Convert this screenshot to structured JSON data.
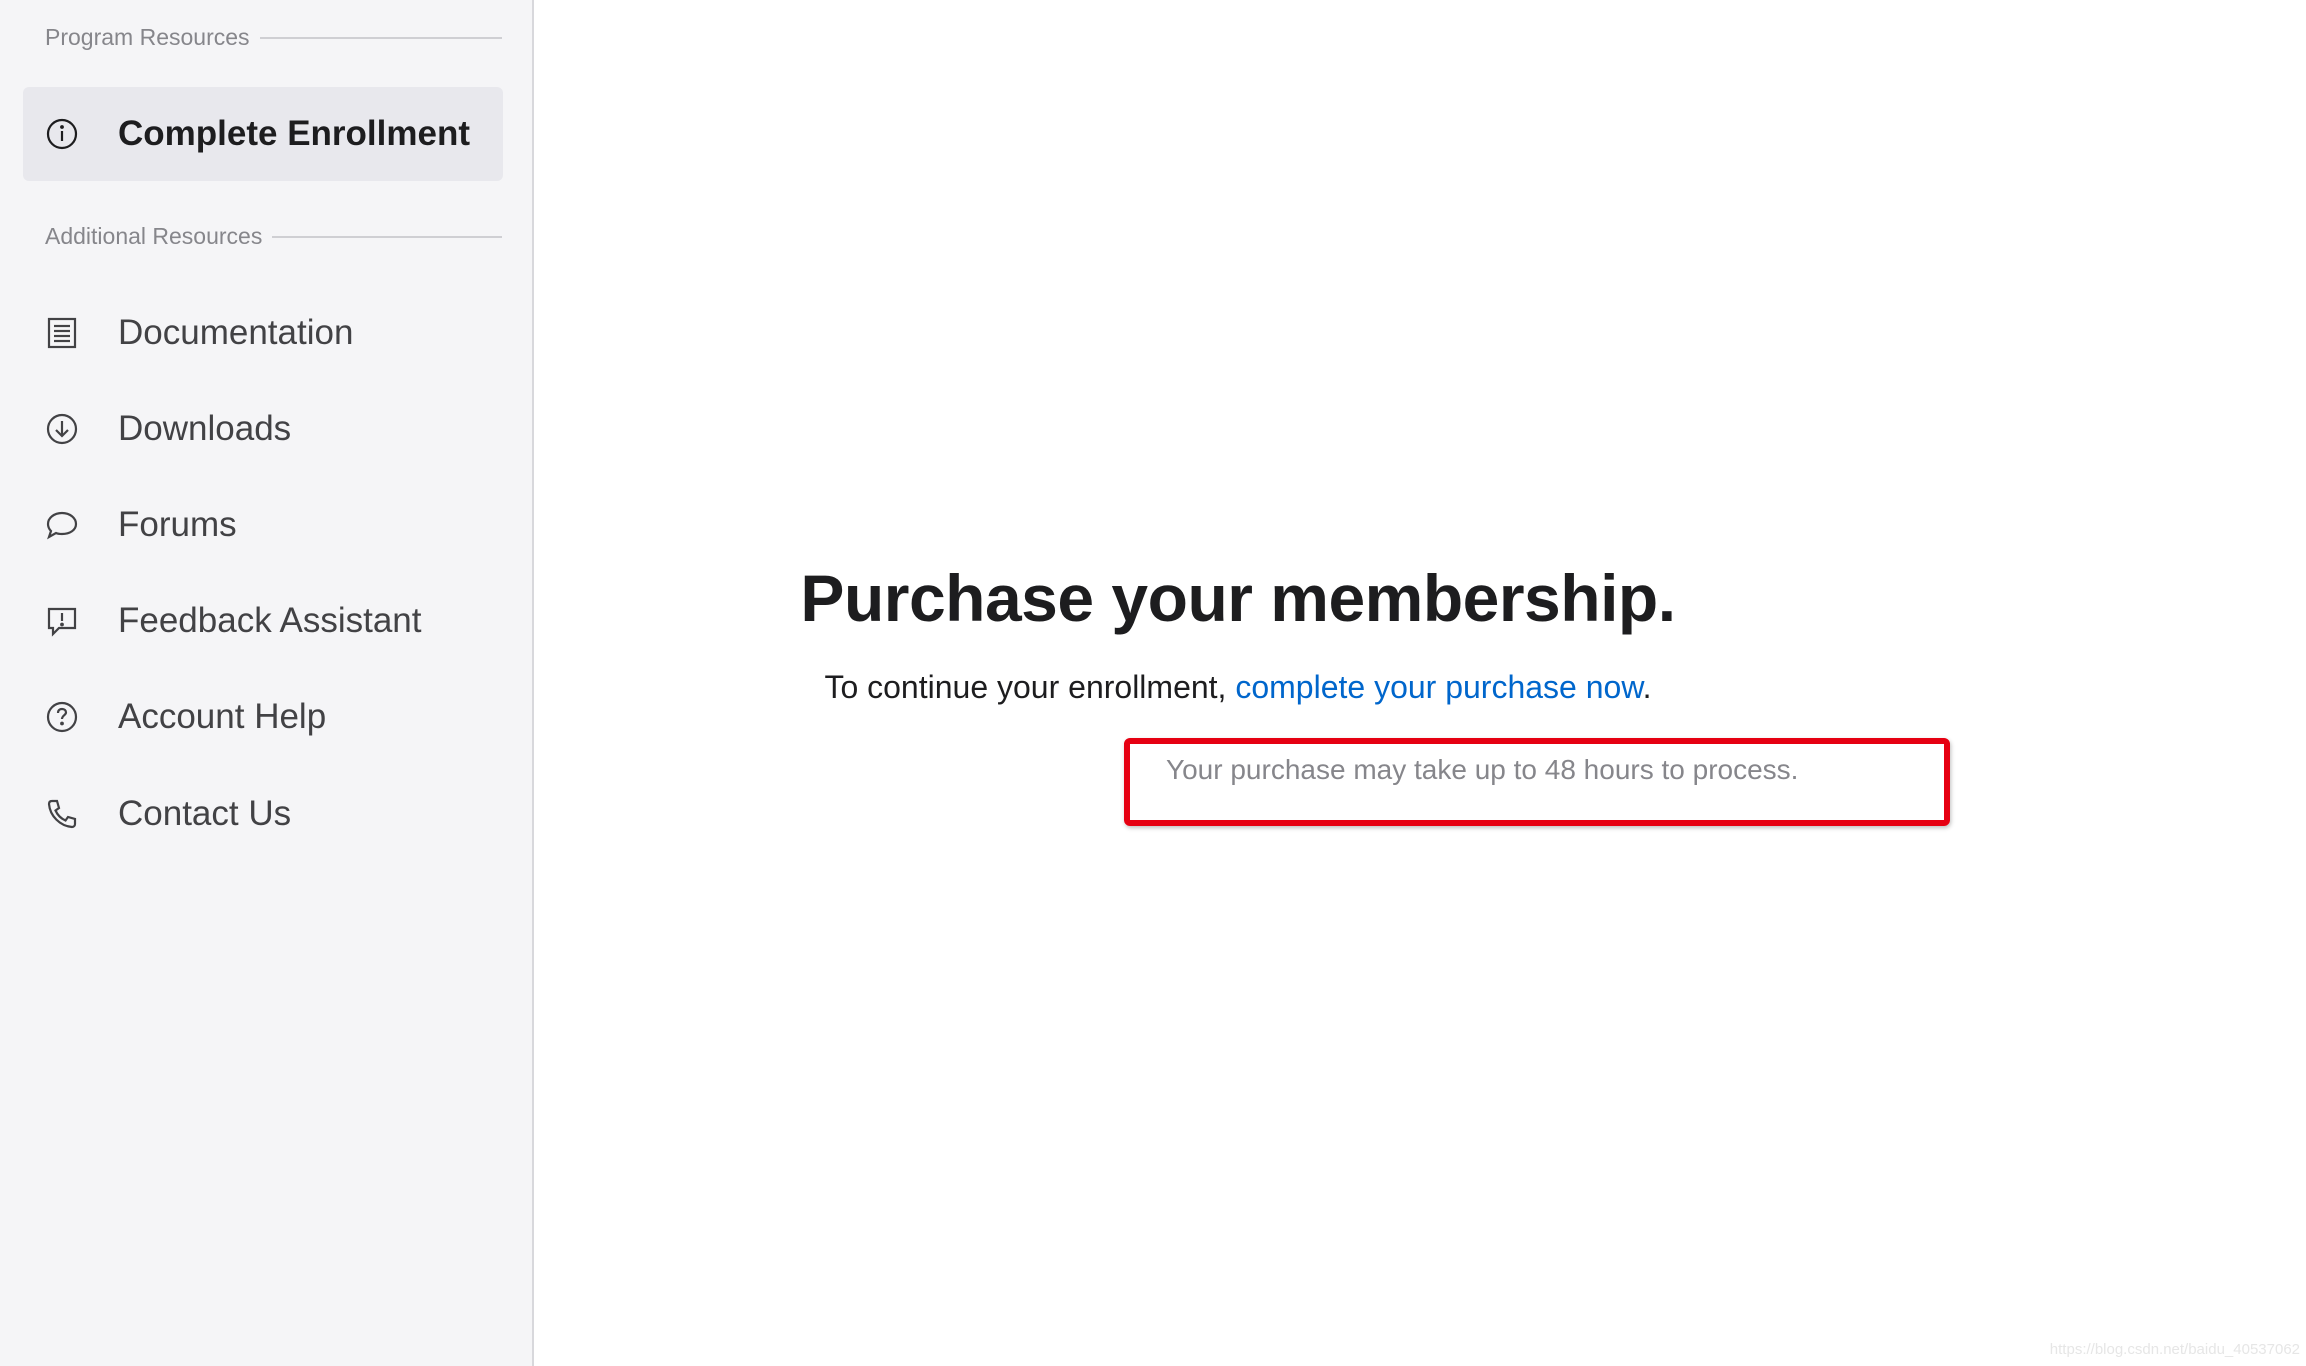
{
  "sidebar": {
    "program_section_label": "Program Resources",
    "active_item": {
      "label": "Complete Enrollment",
      "icon": "info-icon"
    },
    "additional_section_label": "Additional Resources",
    "items": [
      {
        "label": "Documentation",
        "icon": "document-list-icon"
      },
      {
        "label": "Downloads",
        "icon": "download-circle-icon"
      },
      {
        "label": "Forums",
        "icon": "speech-bubble-icon"
      },
      {
        "label": "Feedback Assistant",
        "icon": "feedback-bubble-icon"
      },
      {
        "label": "Account Help",
        "icon": "question-circle-icon"
      },
      {
        "label": "Contact Us",
        "icon": "phone-icon"
      }
    ]
  },
  "main": {
    "title": "Purchase your membership.",
    "lead_prefix": "To continue your enrollment, ",
    "lead_link": "complete your purchase now",
    "lead_suffix": ".",
    "notice": "Your purchase may take up to 48 hours to process."
  },
  "watermark": "https://blog.csdn.net/baidu_40537062",
  "colors": {
    "sidebar_bg": "#f5f5f7",
    "active_bg": "#e8e8ed",
    "link": "#0066cc",
    "highlight_box": "#e60012"
  }
}
